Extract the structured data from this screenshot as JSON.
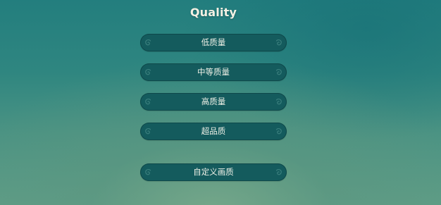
{
  "title": "Quality",
  "buttons": [
    {
      "label": "低质量"
    },
    {
      "label": "中等质量"
    },
    {
      "label": "高质量"
    },
    {
      "label": "超品质"
    },
    {
      "label": "自定义画质"
    }
  ],
  "icons": {
    "left": "swirl-left-icon",
    "right": "swirl-right-icon"
  },
  "colors": {
    "button": "#145b5d",
    "text": "#eef0e6",
    "ornament": "#3a7f7d"
  }
}
